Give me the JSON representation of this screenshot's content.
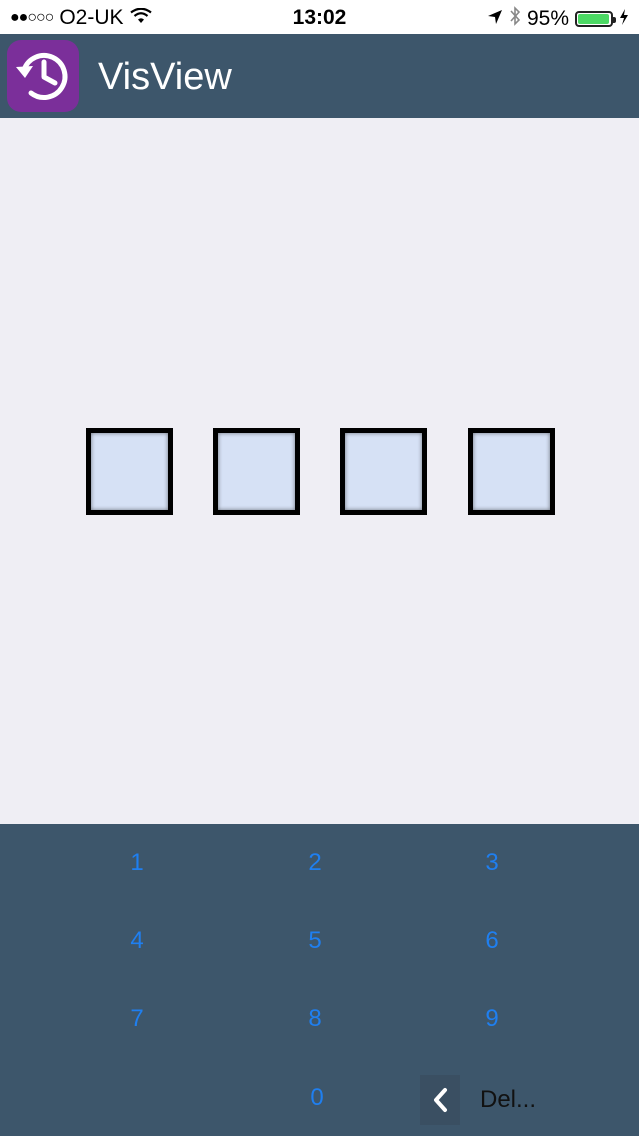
{
  "status_bar": {
    "signal": "●●○○○",
    "carrier": "O2-UK",
    "time": "13:02",
    "battery_percent": "95%",
    "battery_level": 0.95
  },
  "header": {
    "app_title": "VisView",
    "app_icon": "history-clock-icon",
    "app_icon_color": "#7b2f9a",
    "bar_color": "#3d566b"
  },
  "pin": {
    "boxes": [
      "",
      "",
      "",
      ""
    ]
  },
  "keypad": {
    "keys": [
      "1",
      "2",
      "3",
      "4",
      "5",
      "6",
      "7",
      "8",
      "9",
      "0"
    ],
    "delete_label": "Del...",
    "key_color": "#1f7ff0"
  }
}
